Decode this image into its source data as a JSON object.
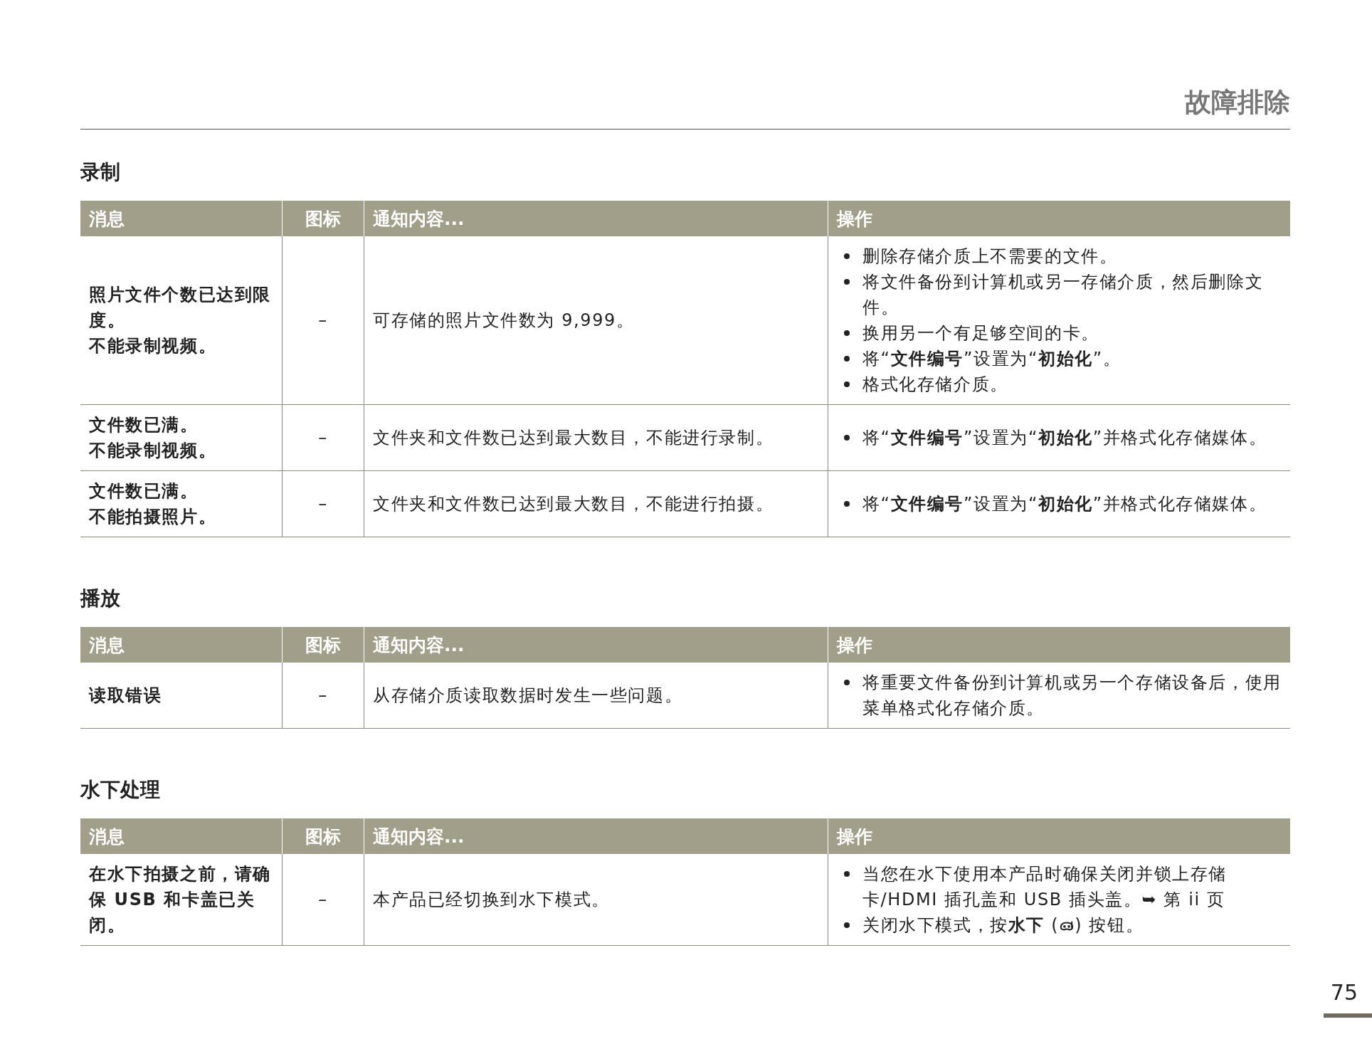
{
  "header": {
    "title": "故障排除"
  },
  "sections": [
    {
      "title": "录制",
      "columns": [
        "消息",
        "图标",
        "通知内容...",
        "操作"
      ],
      "rows": [
        {
          "message": [
            "照片文件个数已达到限度。",
            "不能录制视频。"
          ],
          "icon": "–",
          "content": "可存储的照片文件数为 9,999。",
          "actions": [
            {
              "text": "删除存储介质上不需要的文件。"
            },
            {
              "text": "将文件备份到计算机或另一存储介质，然后删除文件。"
            },
            {
              "text": "换用另一个有足够空间的卡。"
            },
            {
              "text": "将“**文件编号**”设置为“**初始化**”。"
            },
            {
              "text": "格式化存储介质。"
            }
          ]
        },
        {
          "message": [
            "文件数已满。",
            "不能录制视频。"
          ],
          "icon": "–",
          "content": "文件夹和文件数已达到最大数目，不能进行录制。",
          "actions": [
            {
              "text": "将“**文件编号**”设置为“**初始化**”并格式化存储媒体。"
            }
          ]
        },
        {
          "message": [
            "文件数已满。",
            "不能拍摄照片。"
          ],
          "icon": "–",
          "content": "文件夹和文件数已达到最大数目，不能进行拍摄。",
          "actions": [
            {
              "text": "将“**文件编号**”设置为“**初始化**”并格式化存储媒体。"
            }
          ]
        }
      ]
    },
    {
      "title": "播放",
      "columns": [
        "消息",
        "图标",
        "通知内容...",
        "操作"
      ],
      "rows": [
        {
          "message": [
            "读取错误"
          ],
          "icon": "–",
          "content": "从存储介质读取数据时发生一些问题。",
          "actions": [
            {
              "text": "将重要文件备份到计算机或另一个存储设备后，使用菜单格式化存储介质。"
            }
          ]
        }
      ]
    },
    {
      "title": "水下处理",
      "columns": [
        "消息",
        "图标",
        "通知内容...",
        "操作"
      ],
      "rows": [
        {
          "message": [
            "在水下拍摄之前，请确保 USB 和卡盖已关闭。"
          ],
          "icon": "–",
          "content": "本产品已经切换到水下模式。",
          "actions": [
            {
              "text": "当您在水下使用本产品时确保关闭并锁上存储卡/HDMI 插孔盖和 USB 插头盖。➥ 第 ii 页"
            },
            {
              "kind": "with_icon",
              "text": "关闭水下模式，按**水下** (",
              "text_after": ") 按钮。"
            }
          ]
        }
      ]
    }
  ],
  "page_number": "75"
}
